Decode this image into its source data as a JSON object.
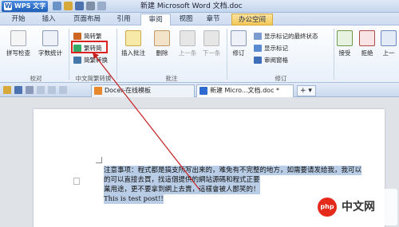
{
  "titlebar": {
    "app_name": "WPS 文字",
    "document_title": "新建 Microsoft Word 文档.doc"
  },
  "ribbon_tabs": [
    "开始",
    "插入",
    "页面布局",
    "引用",
    "审阅",
    "视图",
    "章节",
    "办公空间"
  ],
  "active_tab": "审阅",
  "ribbon": {
    "proofing": {
      "spell_check": "拼写检查",
      "word_count": "字数统计",
      "label": "校对"
    },
    "chinese_conversion": {
      "simp_to_trad": "简转繁",
      "trad_to_simp": "繁转简",
      "simp_trad_conversion": "简繁转换",
      "label": "中文简繁转换"
    },
    "comments": {
      "insert_comment": "插入批注",
      "delete": "删除",
      "previous": "上一条",
      "next": "下一条",
      "label": "批注"
    },
    "tracking": {
      "track_changes": "修订",
      "show_markup_final": "显示标记的最终状态",
      "show_markup": "显示标记",
      "review_pane": "审阅窗格",
      "label": "修订"
    },
    "changes": {
      "accept": "接受",
      "reject": "拒绝",
      "previous": "上一"
    }
  },
  "doc_tabs": [
    {
      "label": "Docer-在线模板"
    },
    {
      "label": "新建 Micro...文档.doc *"
    }
  ],
  "new_tab_label": "+ ▾",
  "document": {
    "lines": [
      "注意事项：程式都是搞支所写出来的，难免有不完整的地方，如需要请发给我，我可以",
      "的可以直接去買，找這個提供的網站源碼和程式正要",
      "業用途，更不要拿到網上去賣，這樣會被人鄙笑的！",
      "This is test post!!"
    ]
  },
  "watermark": {
    "logo": "php",
    "text": "中文网"
  }
}
